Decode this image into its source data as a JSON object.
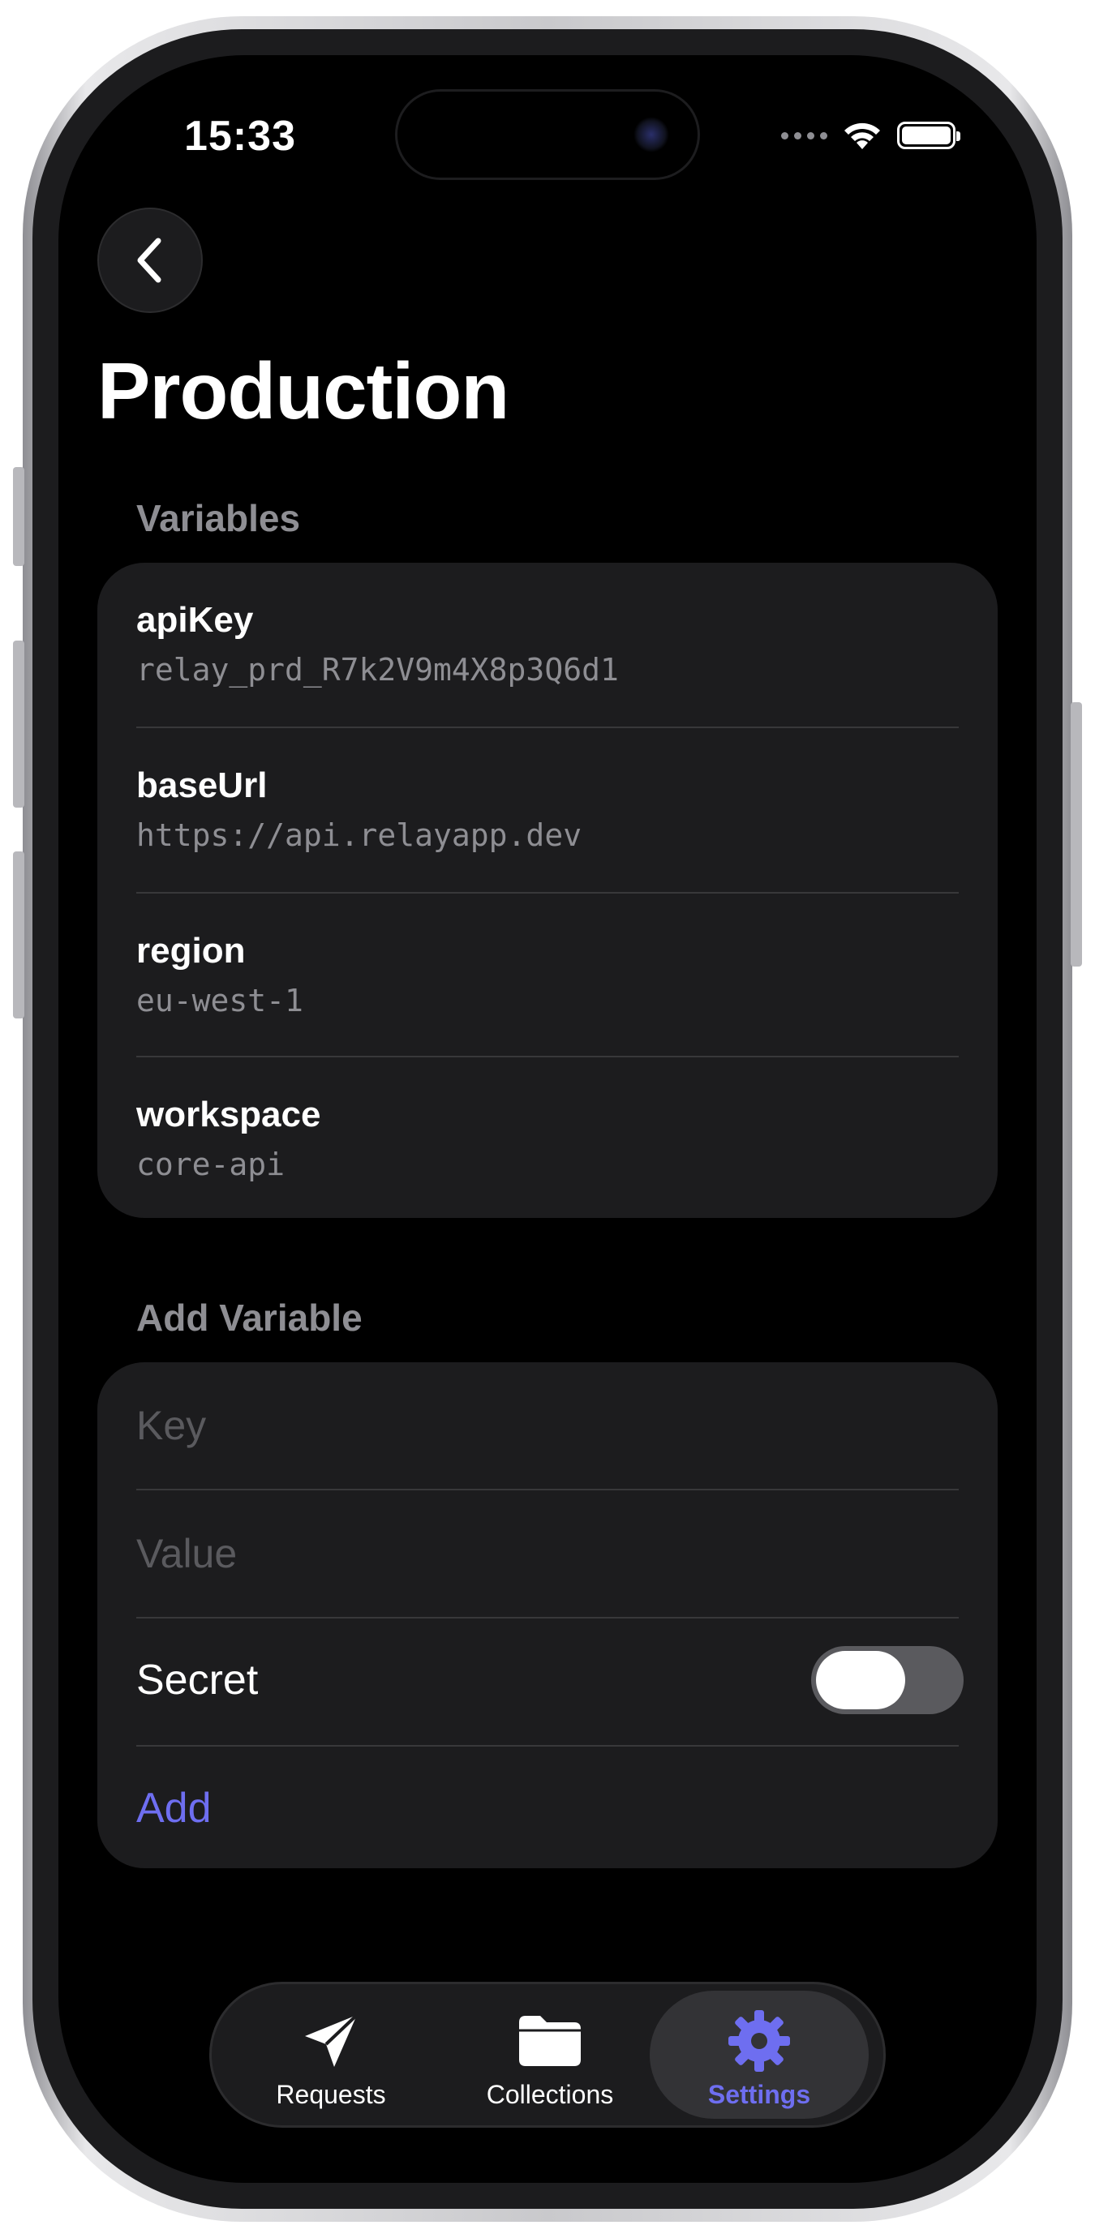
{
  "status_bar": {
    "time": "15:33"
  },
  "header": {
    "back_icon": "chevron-left-icon",
    "title": "Production"
  },
  "variables_section": {
    "header": "Variables",
    "items": [
      {
        "key": "apiKey",
        "value": "relay_prd_R7k2V9m4X8p3Q6d1"
      },
      {
        "key": "baseUrl",
        "value": "https://api.relayapp.dev"
      },
      {
        "key": "region",
        "value": "eu-west-1"
      },
      {
        "key": "workspace",
        "value": "core-api"
      }
    ]
  },
  "add_variable_section": {
    "header": "Add Variable",
    "key_placeholder": "Key",
    "key_value": "",
    "value_placeholder": "Value",
    "value_value": "",
    "secret_label": "Secret",
    "secret_enabled": false,
    "add_label": "Add"
  },
  "tab_bar": {
    "tabs": [
      {
        "label": "Requests",
        "icon": "paper-plane-icon",
        "active": false
      },
      {
        "label": "Collections",
        "icon": "folder-icon",
        "active": false
      },
      {
        "label": "Settings",
        "icon": "gear-icon",
        "active": true
      }
    ]
  },
  "colors": {
    "accent": "#6e6ef0",
    "background": "#000000",
    "card": "#1c1c1e",
    "secondary_text": "#8e8e93"
  }
}
